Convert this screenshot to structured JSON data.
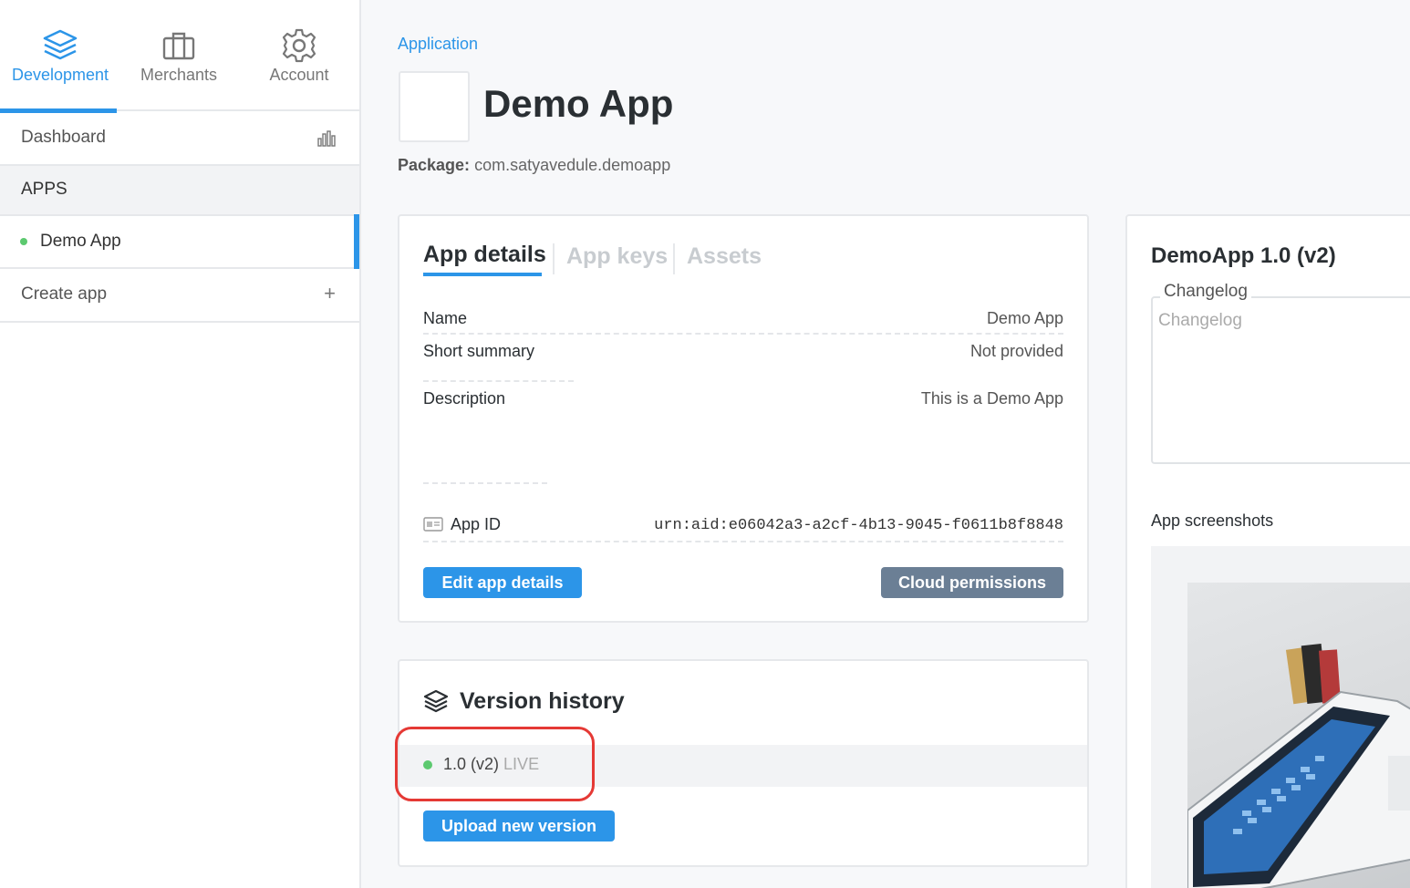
{
  "nav": {
    "tabs": [
      {
        "label": "Development",
        "icon": "layers-icon"
      },
      {
        "label": "Merchants",
        "icon": "briefcase-icon"
      },
      {
        "label": "Account",
        "icon": "gear-icon"
      }
    ]
  },
  "sidebar": {
    "dashboard": "Dashboard",
    "apps_header": "APPS",
    "demo_app": "Demo App",
    "create_app": "Create app",
    "create_icon": "+"
  },
  "main": {
    "breadcrumb": "Application",
    "app_title": "Demo App",
    "package_label": "Package:",
    "package_value": "com.satyavedule.demoapp"
  },
  "details": {
    "tabs": [
      "App details",
      "App keys",
      "Assets"
    ],
    "fields": {
      "name_label": "Name",
      "name_value": "Demo App",
      "summary_label": "Short summary",
      "summary_value": "Not provided",
      "description_label": "Description",
      "description_value": "This is a Demo App",
      "appid_label": "App ID",
      "appid_value": "urn:aid:e06042a3-a2cf-4b13-9045-f0611b8f8848"
    },
    "edit_button": "Edit app details",
    "cloud_button": "Cloud permissions"
  },
  "versions": {
    "title": "Version history",
    "items": [
      {
        "version": "1.0 (v2)",
        "status": "LIVE"
      }
    ],
    "upload_button": "Upload new version"
  },
  "right": {
    "title": "DemoApp 1.0 (v2)",
    "changelog_legend": "Changelog",
    "changelog_placeholder": "Changelog",
    "screenshots_label": "App screenshots"
  },
  "colors": {
    "accent": "#2c95e8",
    "live": "#5cc96f",
    "annotation": "#e53935"
  }
}
